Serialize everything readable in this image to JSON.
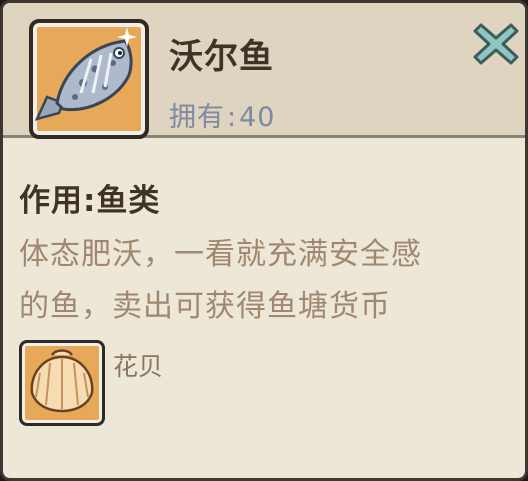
{
  "item": {
    "name": "沃尔鱼",
    "owned_label": "拥有",
    "owned_colon": ":",
    "owned_count": "40",
    "icon": "fish-icon"
  },
  "close": {
    "icon": "close-x-icon"
  },
  "usage": {
    "label": "作用",
    "colon": ":",
    "value": "鱼类"
  },
  "description": {
    "line1": "体态肥沃，一看就充满安全感",
    "line2": "的鱼，卖出可获得鱼塘货币"
  },
  "source": {
    "label": "花贝",
    "icon": "scallop-shell-icon"
  },
  "colors": {
    "panel_bg": "#ede7d8",
    "header_bg": "#ded4bf",
    "frame_fill": "#e8a85a",
    "title_text": "#3f3328",
    "owned_text": "#7d8aa1",
    "desc_text": "#a08870",
    "close_icon": "#8ec7c2"
  }
}
